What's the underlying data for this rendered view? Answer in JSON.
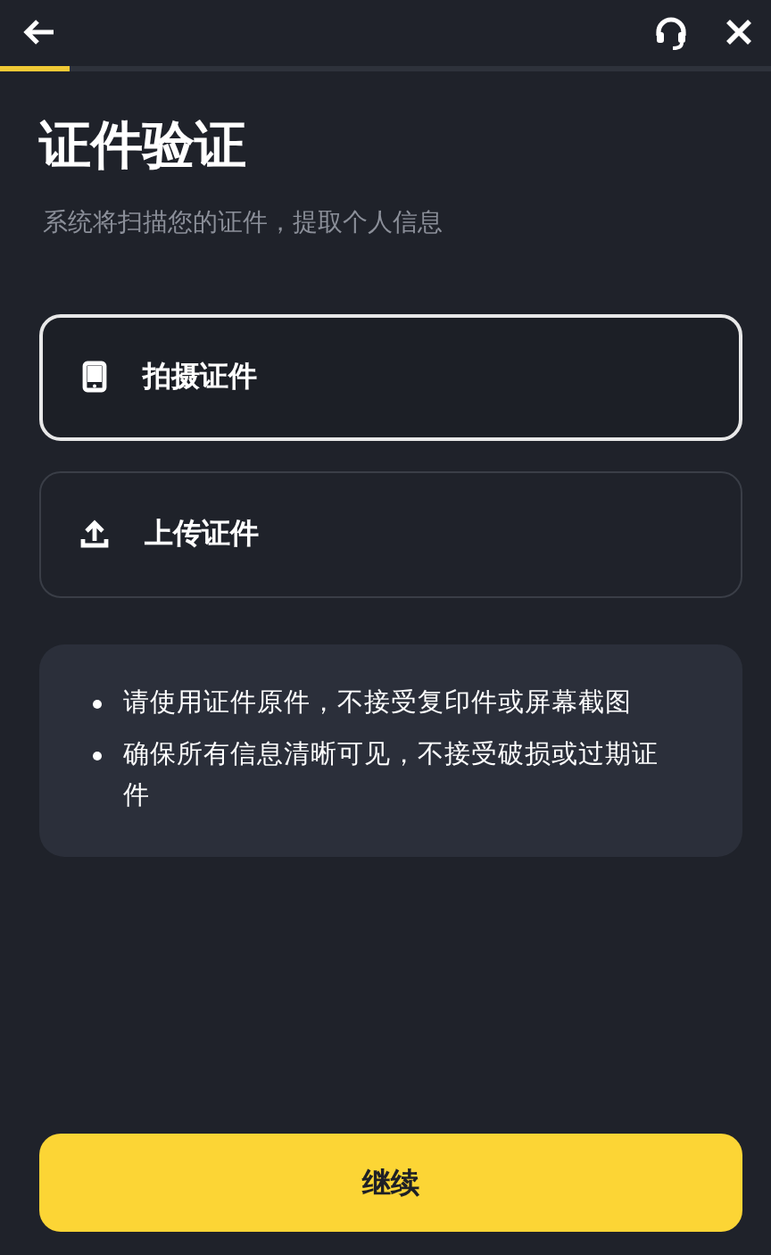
{
  "header": {
    "progress": {
      "level": 0.09
    }
  },
  "title": "证件验证",
  "subtitle": "系统将扫描您的证件，提取个人信息",
  "options": [
    {
      "kind": "camera",
      "label": "拍摄证件",
      "selected": true
    },
    {
      "kind": "upload",
      "label": "上传证件",
      "selected": false
    }
  ],
  "notes": [
    "请使用证件原件，不接受复印件或屏幕截图",
    "确保所有信息清晰可见，不接受破损或过期证件"
  ],
  "continue_button": "继续"
}
